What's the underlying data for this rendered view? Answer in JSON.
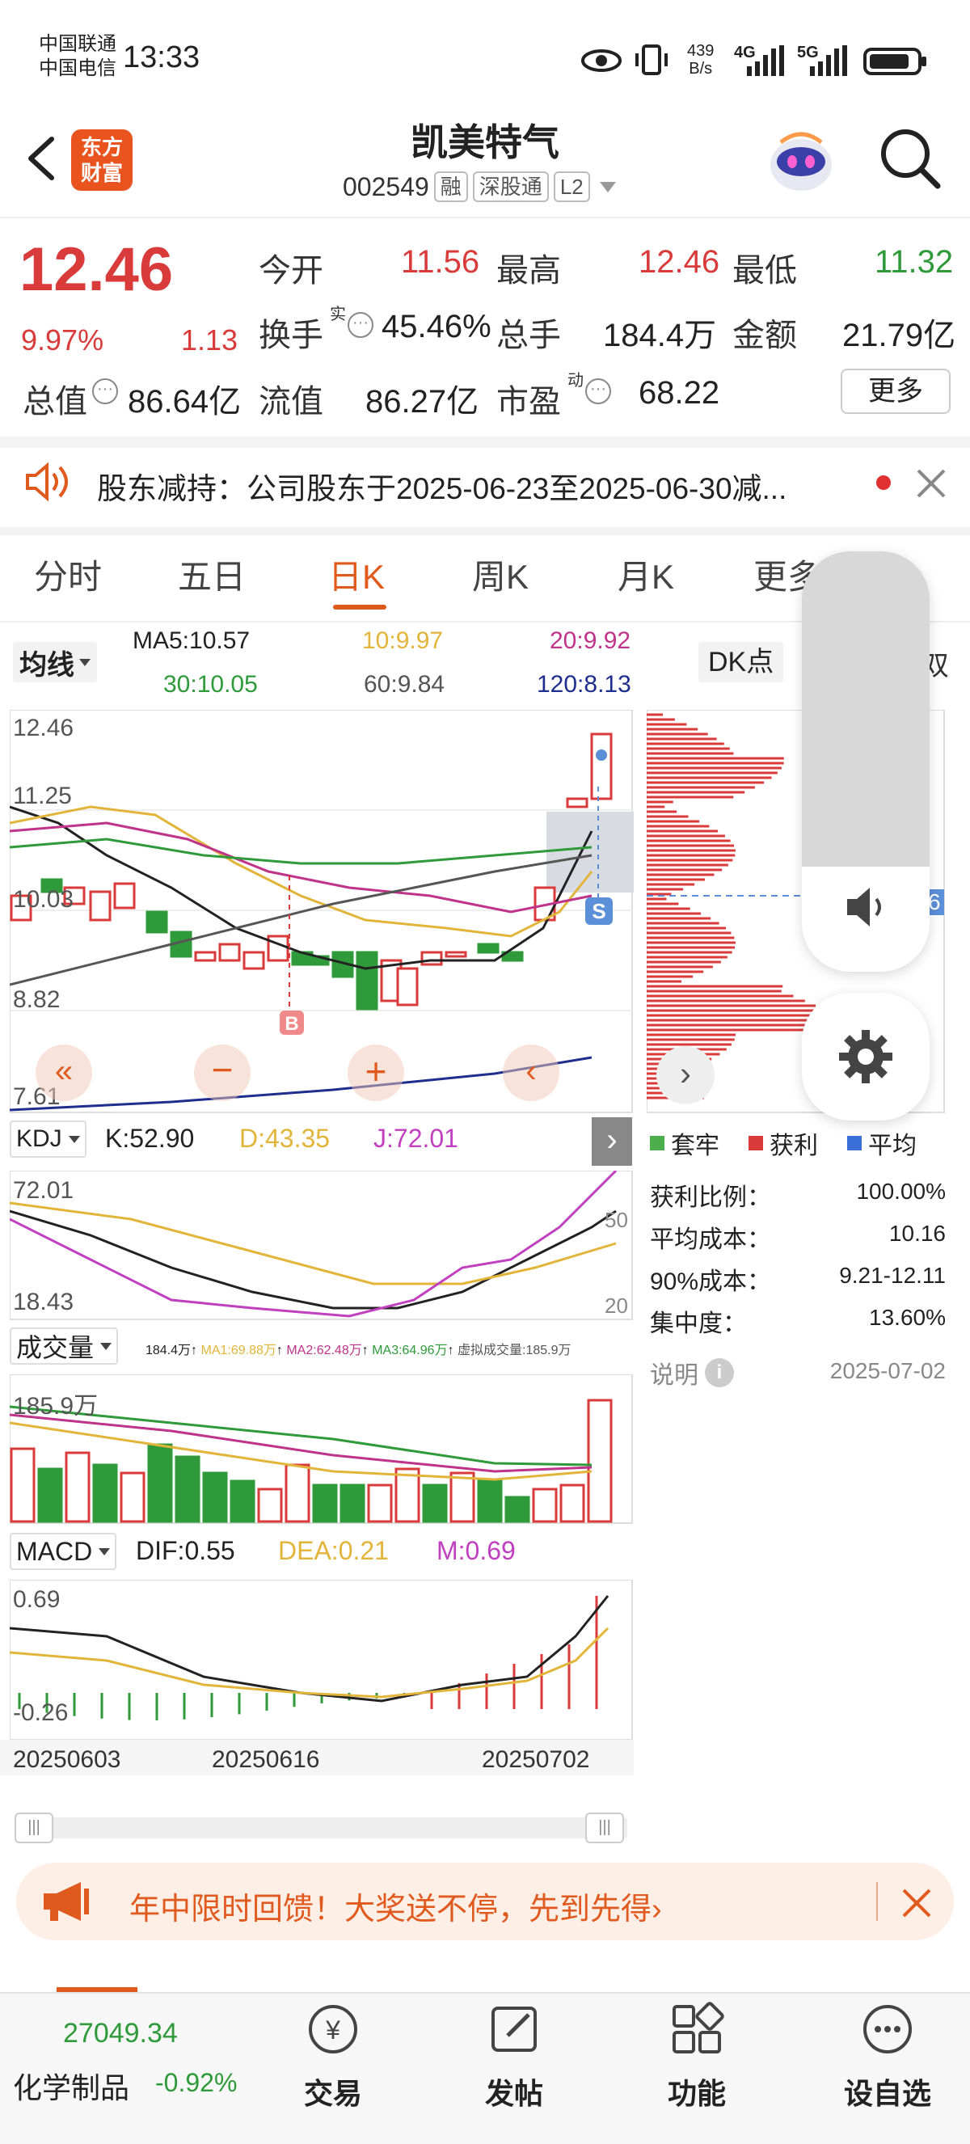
{
  "status_bar": {
    "carrier_1": "中国联通",
    "carrier_2": "中国电信",
    "time": "13:33",
    "net_speed_value": "439",
    "net_speed_unit": "B/s",
    "net_4g": "4G",
    "net_5g": "5G"
  },
  "header": {
    "logo_line1": "东方",
    "logo_line2": "财富",
    "title": "凯美特气",
    "code": "002549",
    "tag_margin": "融",
    "tag_connect": "深股通",
    "tag_level": "L2"
  },
  "quote": {
    "price": "12.46",
    "change_pct": "9.97%",
    "change_abs": "1.13",
    "open_label": "今开",
    "open_value": "11.56",
    "high_label": "最高",
    "high_value": "12.46",
    "low_label": "最低",
    "low_value": "11.32",
    "turnover_label": "换手",
    "turnover_sup": "实",
    "turnover_value": "45.46%",
    "volume_label": "总手",
    "volume_value": "184.4万",
    "amount_label": "金额",
    "amount_value": "21.79亿",
    "mktcap_label": "总值",
    "mktcap_value": "86.64亿",
    "float_label": "流值",
    "float_value": "86.27亿",
    "pe_label": "市盈",
    "pe_sup": "动",
    "pe_value": "68.22",
    "more_button": "更多"
  },
  "notice": {
    "text": "股东减持：公司股东于2025-06-23至2025-06-30减..."
  },
  "tabs": [
    "分时",
    "五日",
    "日K",
    "周K",
    "月K",
    "更多"
  ],
  "active_tab_index": 2,
  "ma_bar": {
    "selector": "均线",
    "ma5": "MA5:10.57",
    "ma10": "10:9.97",
    "ma20": "20:9.92",
    "ma30": "30:10.05",
    "ma60": "60:9.84",
    "ma120": "120:8.13",
    "dk_label": "DK点",
    "right_tag": "双"
  },
  "kline": {
    "y_labels": [
      "12.46",
      "11.25",
      "10.03",
      "8.82",
      "7.61"
    ],
    "buy_marker": "B",
    "sell_marker": "S",
    "side_value": "6"
  },
  "kdj": {
    "selector": "KDJ",
    "k": "K:52.90",
    "d": "D:43.35",
    "j": "J:72.01",
    "y_top": "72.01",
    "y_bottom": "18.43",
    "right_50": "50",
    "right_20": "20"
  },
  "volume": {
    "selector": "成交量",
    "legend": "184.4万↑ MA1:69.88万↑ MA2:62.48万↑ MA3:64.96万↑ 虚拟成交量:185.9万",
    "legend_total": "184.4万",
    "legend_ma1": "MA1:69.88万",
    "legend_ma2": "MA2:62.48万",
    "legend_ma3": "MA3:64.96万",
    "legend_virtual": "虚拟成交量:185.9万",
    "y_top": "185.9万"
  },
  "macd": {
    "selector": "MACD",
    "dif": "DIF:0.55",
    "dea": "DEA:0.21",
    "m": "M:0.69",
    "y_top": "0.69",
    "y_bottom": "-0.26"
  },
  "x_dates": [
    "20250603",
    "20250616",
    "20250702"
  ],
  "chip_panel": {
    "legend_trapped": "套牢",
    "legend_profit": "获利",
    "legend_avg": "平均",
    "profit_ratio_label": "获利比例：",
    "profit_ratio": "100.00%",
    "avg_cost_label": "平均成本：",
    "avg_cost": "10.16",
    "cost90_label": "90%成本：",
    "cost90": "9.21-12.11",
    "concentration_label": "集中度：",
    "concentration": "13.60%",
    "note_label": "说明",
    "date": "2025-07-02"
  },
  "promo": {
    "text": "年中限时回馈！大奖送不停，先到先得"
  },
  "bottom_bar": {
    "index_value": "27049.34",
    "index_name": "化学制品",
    "index_change": "-0.92%",
    "trade": "交易",
    "post": "发帖",
    "features": "功能",
    "watchlist": "设自选"
  },
  "colors": {
    "up": "#d93a3a",
    "down": "#2e9a3a",
    "accent": "#e05a1e",
    "ma5": "#222222",
    "ma10": "#e2b53a",
    "ma20": "#c0338a",
    "ma30": "#2e9a3a",
    "ma60": "#555555",
    "ma120": "#1e2e8e"
  }
}
